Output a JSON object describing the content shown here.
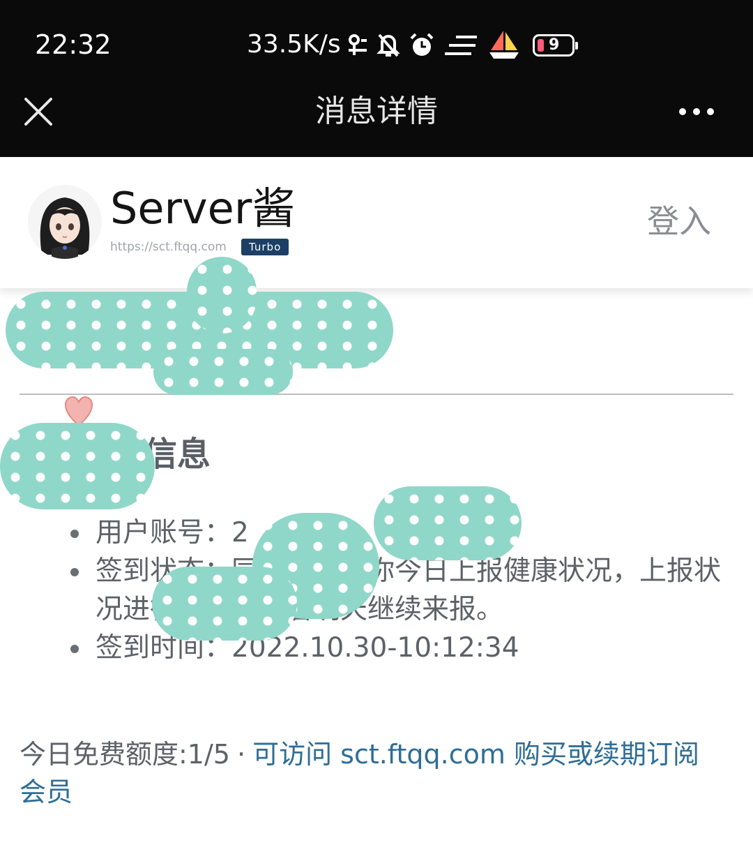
{
  "status_bar": {
    "time": "22:32",
    "net_speed": "33.5K/s",
    "battery_level": "9",
    "icons": [
      "network-icon",
      "mute-bell-icon",
      "alarm-icon",
      "speed-lines-icon",
      "sailboat-icon",
      "battery-icon"
    ]
  },
  "nav": {
    "title": "消息详情",
    "close_icon": "close-icon",
    "more_icon": "more-dots-icon"
  },
  "header": {
    "brand_name": "Server酱",
    "url": "https://sct.ftqq.com",
    "badge": "Turbo",
    "login": "登入"
  },
  "message": {
    "section_title": "信息",
    "items": [
      {
        "label": "用户账号：",
        "value": "2"
      },
      {
        "label": "签到状态：",
        "value": "同学，感谢你今日上报健康状况，上报状况进行审核。记着明天继续来报。"
      },
      {
        "label": "签到时间：",
        "value": "2022.10.30-10:12:34"
      }
    ]
  },
  "footer": {
    "quota_text": "今日免费额度:1/5",
    "separator": "·",
    "link_text": "可访问 sct.ftqq.com 购买或续期订阅会员"
  },
  "colors": {
    "topbar": "#0a0a0a",
    "badge": "#1c3f66",
    "link": "#2f6d96",
    "redaction": "#8fd7c9",
    "battery_low": "#ff5a7a"
  }
}
